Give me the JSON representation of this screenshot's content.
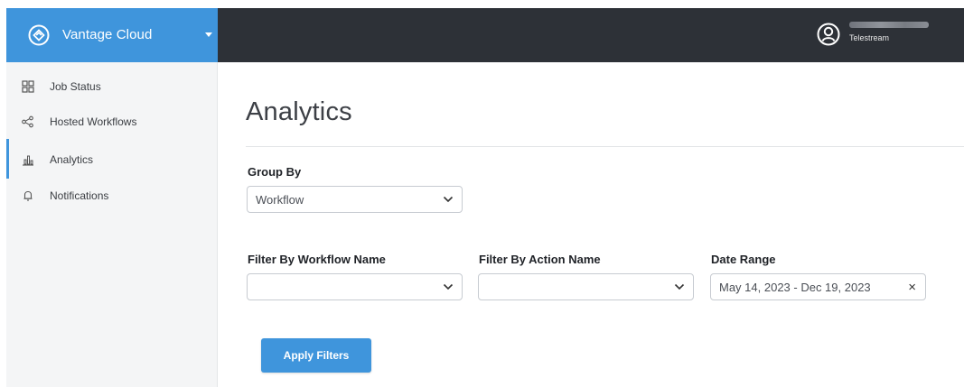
{
  "brand": {
    "name": "Vantage Cloud",
    "logo_icon": "vantage-cloud-logo-icon",
    "color": "#3f95dc"
  },
  "header": {
    "user_org": "Telestream",
    "user_icon": "user-account-icon",
    "background": "#2d3137"
  },
  "sidebar": {
    "items": [
      {
        "label": "Job Status",
        "icon": "job-status-grid-icon",
        "active": false
      },
      {
        "label": "Hosted Workflows",
        "icon": "workflow-nodes-icon",
        "active": false
      },
      {
        "label": "Analytics",
        "icon": "bar-chart-icon",
        "active": true
      },
      {
        "label": "Notifications",
        "icon": "bell-icon",
        "active": false
      }
    ]
  },
  "main": {
    "title": "Analytics",
    "group_by": {
      "label": "Group By",
      "value": "Workflow"
    },
    "filters": {
      "workflow_name": {
        "label": "Filter By Workflow Name",
        "value": ""
      },
      "action_name": {
        "label": "Filter By Action Name",
        "value": ""
      },
      "date_range": {
        "label": "Date Range",
        "value": "May 14, 2023 - Dec 19, 2023",
        "clear": "×"
      }
    },
    "apply_label": "Apply Filters"
  }
}
